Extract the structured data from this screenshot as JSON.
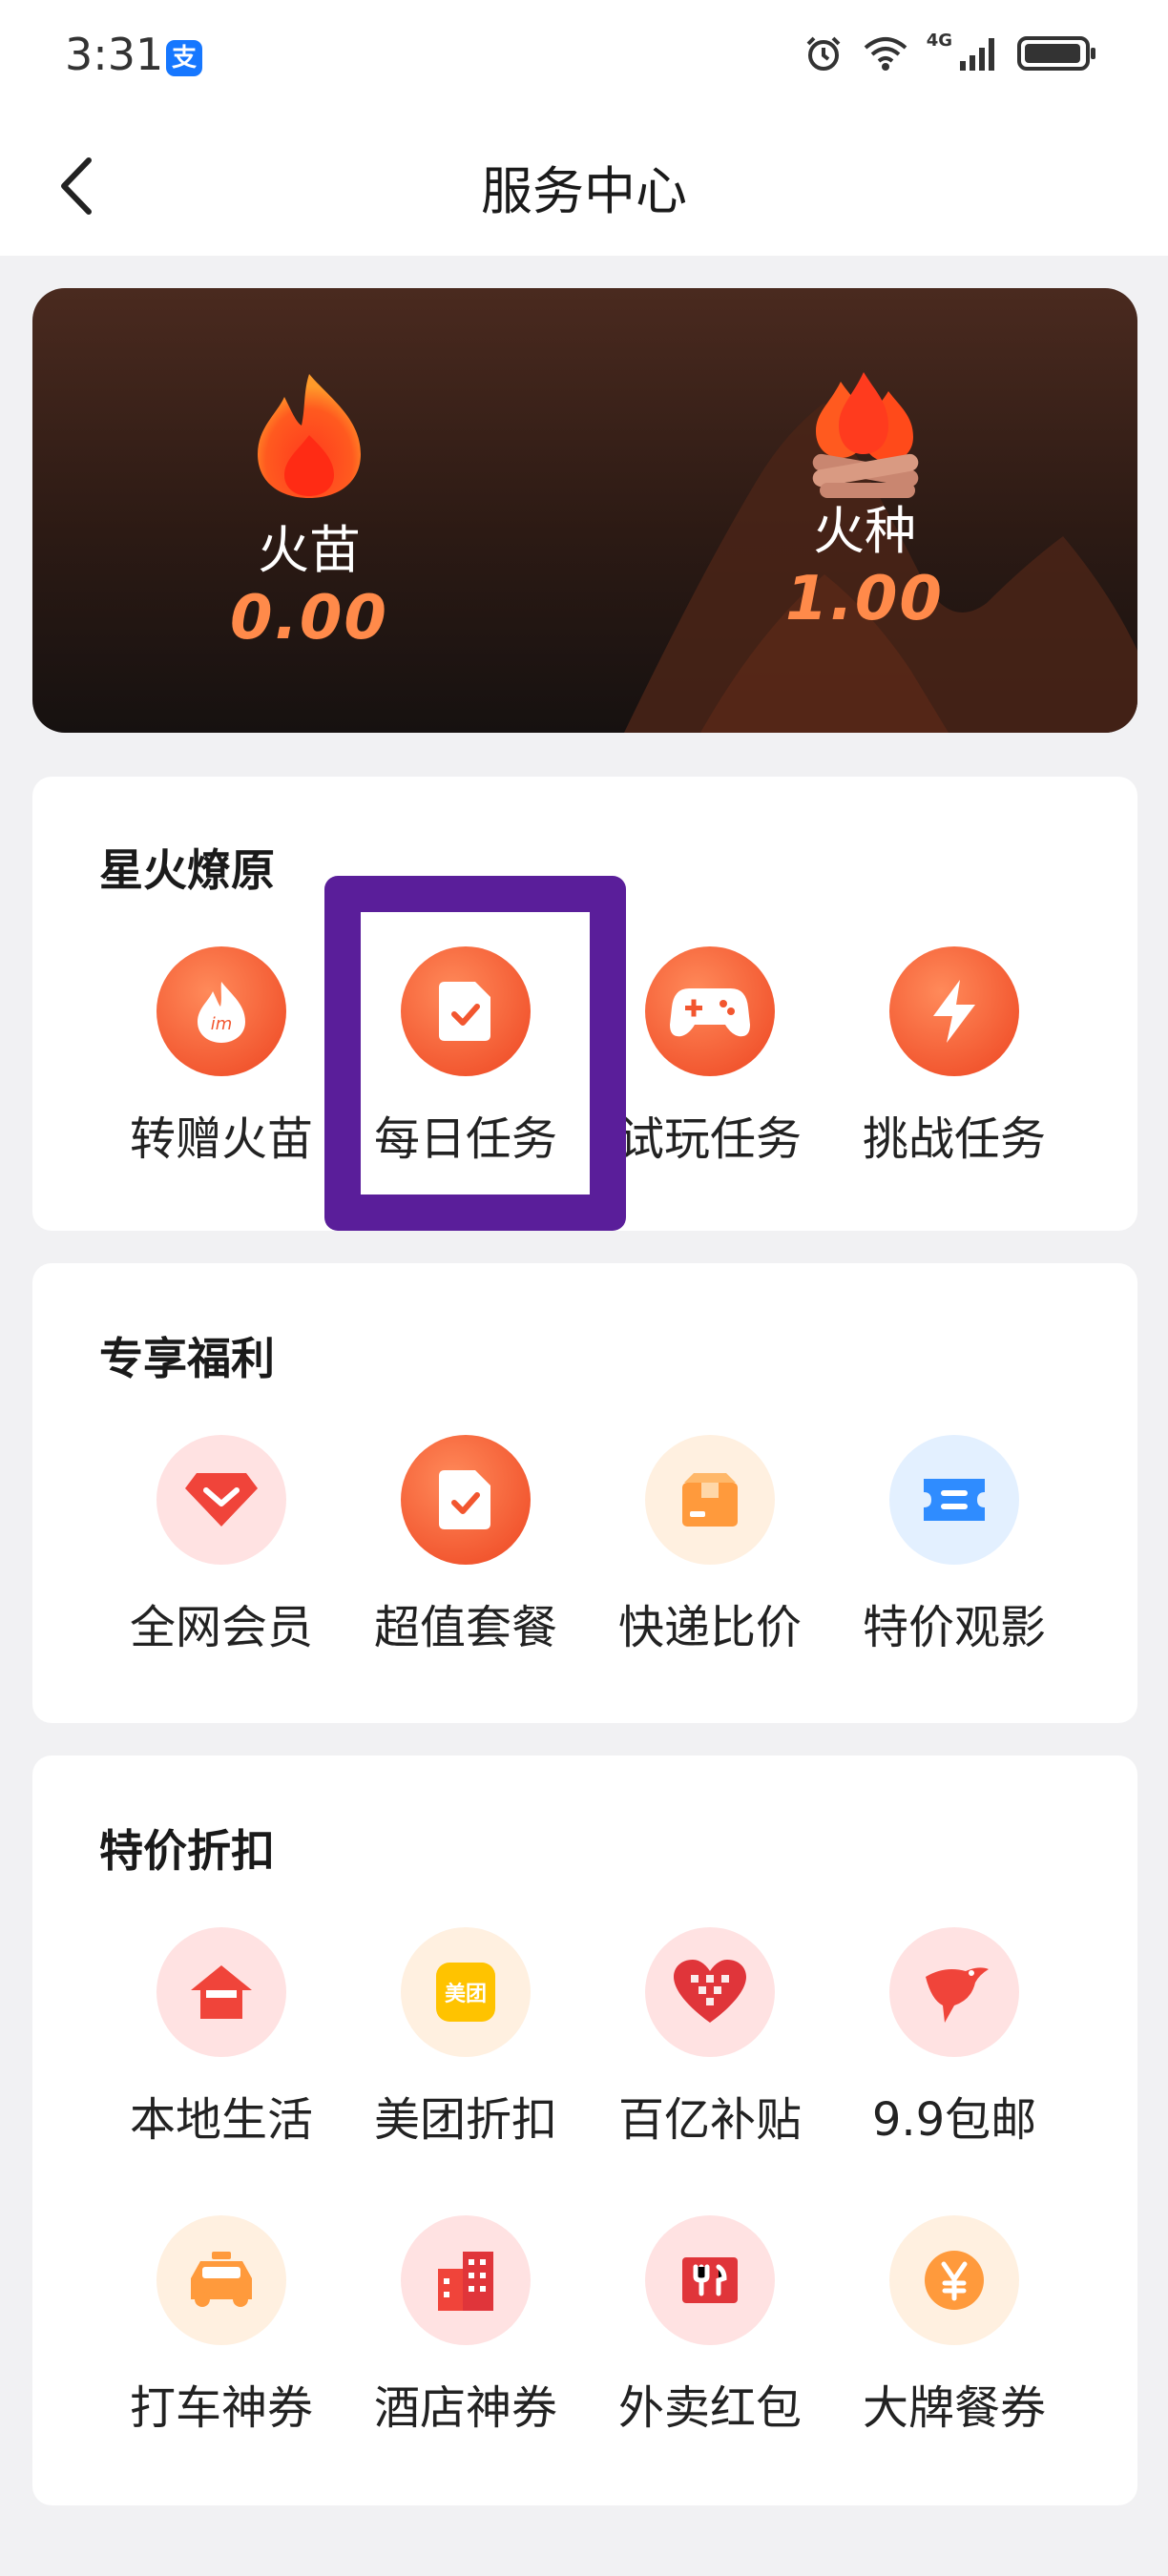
{
  "status_bar": {
    "time": "3:31",
    "app_badge": "支",
    "network": "4G"
  },
  "nav": {
    "title": "服务中心",
    "back_icon": "chevron-left-icon"
  },
  "hero": {
    "left": {
      "label": "火苗",
      "value": "0.00",
      "icon": "flame-icon"
    },
    "right": {
      "label": "火种",
      "value": "1.00",
      "icon": "campfire-icon"
    }
  },
  "sections": [
    {
      "title": "星火燎原",
      "items": [
        {
          "label": "转赠火苗",
          "icon": "gift-flame-icon",
          "style": "orange"
        },
        {
          "label": "每日任务",
          "icon": "task-document-icon",
          "style": "orange"
        },
        {
          "label": "试玩任务",
          "icon": "gamepad-icon",
          "style": "orange"
        },
        {
          "label": "挑战任务",
          "icon": "lightning-icon",
          "style": "orange"
        }
      ]
    },
    {
      "title": "专享福利",
      "items": [
        {
          "label": "全网会员",
          "icon": "diamond-icon",
          "style": "pink"
        },
        {
          "label": "超值套餐",
          "icon": "package-document-icon",
          "style": "orange"
        },
        {
          "label": "快递比价",
          "icon": "parcel-box-icon",
          "style": "peach"
        },
        {
          "label": "特价观影",
          "icon": "movie-ticket-icon",
          "style": "blue"
        }
      ]
    },
    {
      "title": "特价折扣",
      "items": [
        {
          "label": "本地生活",
          "icon": "home-icon",
          "style": "pink"
        },
        {
          "label": "美团折扣",
          "icon": "meituan-logo-icon",
          "style": "peach",
          "logo_text": "美团"
        },
        {
          "label": "百亿补贴",
          "icon": "pinduoduo-heart-icon",
          "style": "pink"
        },
        {
          "label": "9.9包邮",
          "icon": "bird-logo-icon",
          "style": "pink"
        },
        {
          "label": "打车神券",
          "icon": "taxi-icon",
          "style": "peach"
        },
        {
          "label": "酒店神券",
          "icon": "hotel-building-icon",
          "style": "pink"
        },
        {
          "label": "外卖红包",
          "icon": "takeout-utensils-icon",
          "style": "pink"
        },
        {
          "label": "大牌餐券",
          "icon": "yen-coin-icon",
          "style": "peach"
        }
      ]
    }
  ],
  "highlighted_item": "每日任务",
  "colors": {
    "accent": "#f2562f",
    "highlight_border": "#5a1e9a",
    "hero_value": "#ff8a4a"
  }
}
